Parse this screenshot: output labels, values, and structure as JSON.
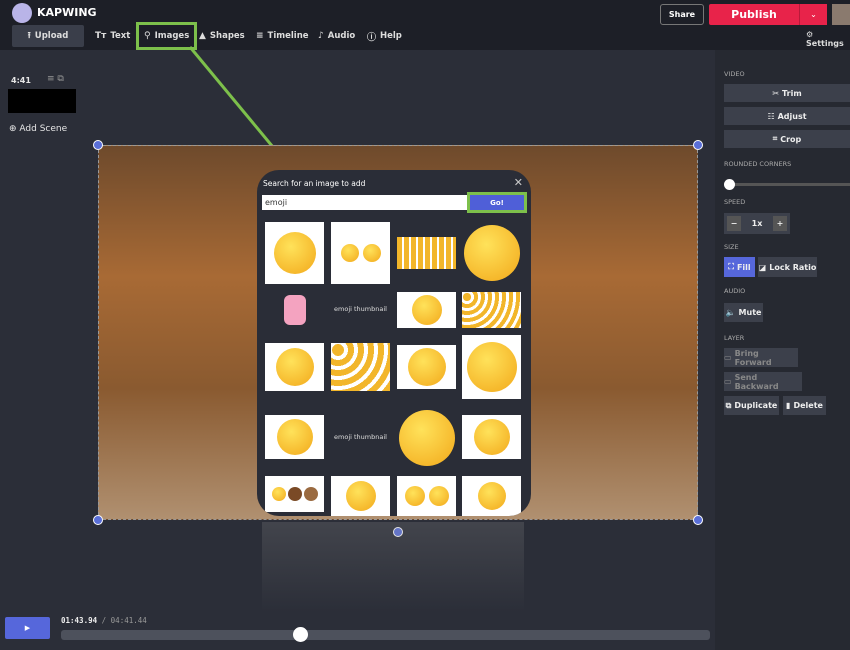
{
  "header": {
    "brand": "KAPWING",
    "share": "Share",
    "publish": "Publish",
    "settings": "Settings",
    "nav": [
      {
        "label": "Upload",
        "icon": "upload-icon"
      },
      {
        "label": "Text",
        "icon": "text-icon"
      },
      {
        "label": "Images",
        "icon": "search-icon"
      },
      {
        "label": "Shapes",
        "icon": "shapes-icon"
      },
      {
        "label": "Timeline",
        "icon": "timeline-icon"
      },
      {
        "label": "Audio",
        "icon": "music-icon"
      },
      {
        "label": "Help",
        "icon": "help-icon"
      }
    ]
  },
  "scenes": {
    "duration": "4:41",
    "add_scene": "Add Scene"
  },
  "modal": {
    "title": "Search for an image to add",
    "query": "emoji",
    "go": "Go!",
    "broken_alt": "emoji thumbnail"
  },
  "panel": {
    "video_label": "VIDEO",
    "trim": "Trim",
    "adjust": "Adjust",
    "crop": "Crop",
    "rounded_label": "ROUNDED CORNERS",
    "rounded_value": 0,
    "speed_label": "SPEED",
    "speed": "1x",
    "size_label": "SIZE",
    "fill": "Fill",
    "lock_ratio": "Lock Ratio",
    "audio_label": "AUDIO",
    "mute": "Mute",
    "layer_label": "LAYER",
    "bring_forward": "Bring Forward",
    "send_backward": "Send Backward",
    "duplicate": "Duplicate",
    "delete": "Delete"
  },
  "playback": {
    "current": "01:43.94",
    "separator": "/",
    "total": "04:41.44",
    "progress": 0.369
  },
  "colors": {
    "accent": "#5667db",
    "publish": "#e8234a",
    "highlight": "#7dc04b"
  }
}
